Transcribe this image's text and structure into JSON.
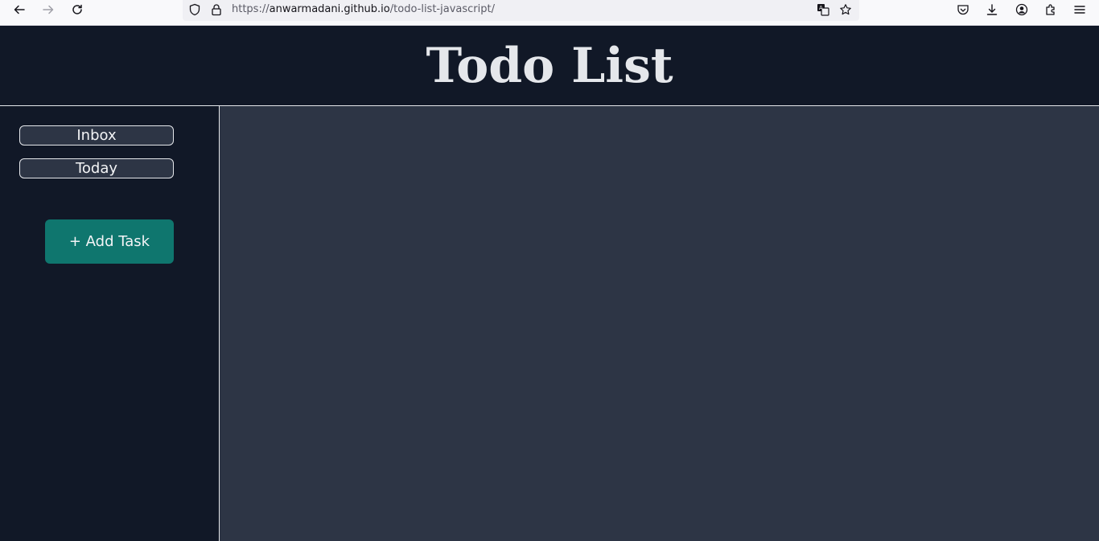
{
  "browser": {
    "url_prefix": "https://",
    "url_host": "anwarmadani.github.io",
    "url_path": "/todo-list-javascript/",
    "icons": [
      "back-icon",
      "forward-icon",
      "reload-icon",
      "shield-icon",
      "lock-icon",
      "translate-icon",
      "star-icon",
      "pocket-icon",
      "download-icon",
      "account-icon",
      "extensions-icon",
      "menu-icon"
    ]
  },
  "header": {
    "title": "Todo List"
  },
  "sidebar": {
    "items": [
      {
        "label": "Inbox"
      },
      {
        "label": "Today"
      }
    ],
    "add_task_label": "+ Add Task"
  },
  "colors": {
    "header_bg": "#111827",
    "main_bg": "#2d3545",
    "accent": "#0f766e",
    "text": "#e5e7eb"
  }
}
